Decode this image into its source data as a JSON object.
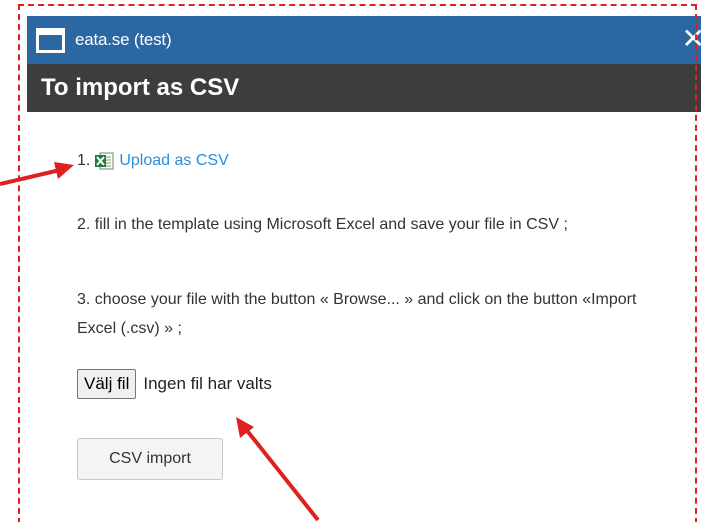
{
  "window": {
    "title": "eata.se (test)",
    "close_glyph": "✕"
  },
  "header": {
    "title": "To import as CSV"
  },
  "steps": {
    "step1_number": "1.",
    "step1_icon": "excel-csv-icon",
    "step1_link": "Upload as CSV",
    "step2": "2. fill in the template using Microsoft Excel and save your file in CSV ;",
    "step3": "3. choose your file with the button « Browse... » and click on the button «Import Excel (.csv) » ;"
  },
  "file_input": {
    "button_label": "Välj fil",
    "status": "Ingen fil har valts"
  },
  "import_button": {
    "label": "CSV import"
  },
  "colors": {
    "titlebar": "#2a67a3",
    "header": "#3d3d3d",
    "link": "#2a8fd8",
    "annotation": "#e02020"
  }
}
